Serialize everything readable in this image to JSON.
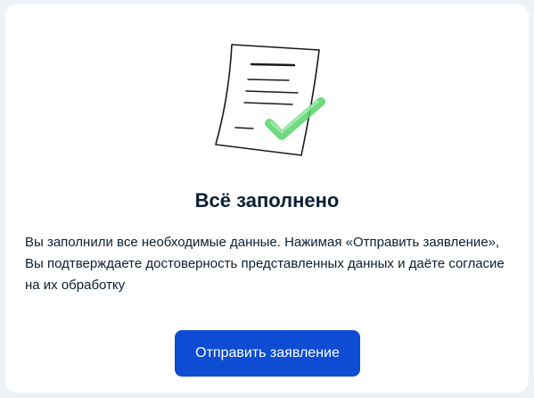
{
  "illustration": {
    "icon": "document-check-icon",
    "paper_color": "#ffffff",
    "line_color": "#1a1a1a",
    "check_color": "#57d36a"
  },
  "status": {
    "title": "Всё заполнено",
    "description": "Вы заполнили все необходимые данные. Нажимая «Отправить заявление», Вы подтверждаете достоверность представленных данных и даёте согласие на их обработку"
  },
  "actions": {
    "submit_label": "Отправить заявление",
    "submit_color": "#0d4cd3"
  }
}
